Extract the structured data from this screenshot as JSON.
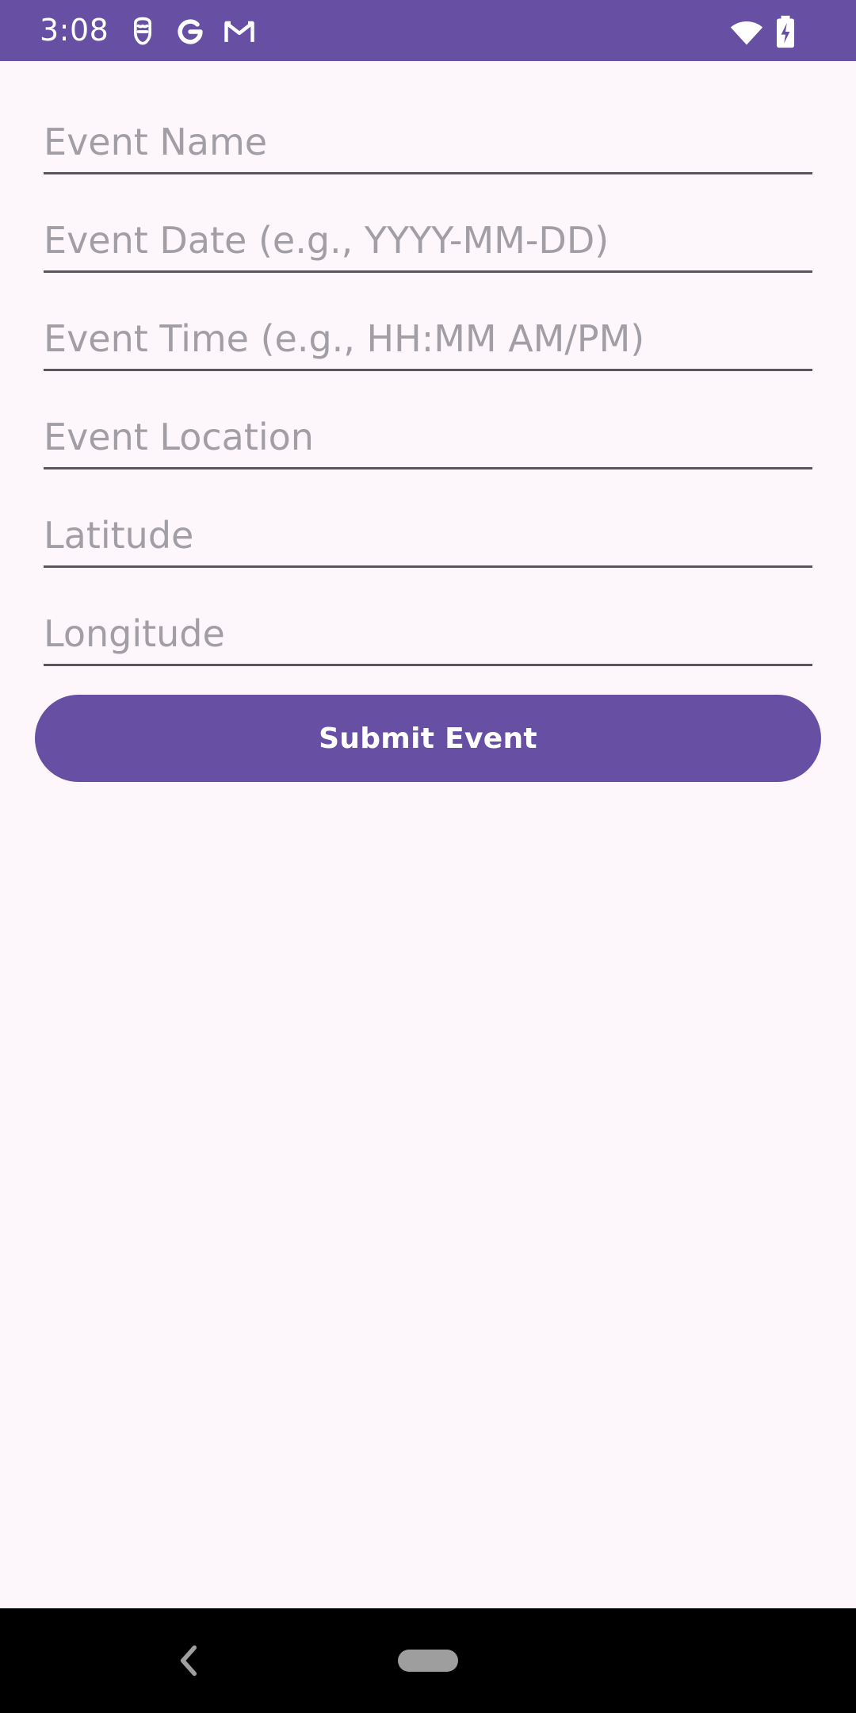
{
  "status_bar": {
    "time": "3:08",
    "background_color": "#6750a4",
    "left_icons": [
      "alien-face-icon",
      "google-g-icon",
      "gmail-icon"
    ],
    "right_icons": [
      "wifi-icon",
      "battery-charging-icon"
    ]
  },
  "form": {
    "fields": [
      {
        "name": "event-name",
        "value": "",
        "placeholder": "Event Name"
      },
      {
        "name": "event-date",
        "value": "",
        "placeholder": "Event Date (e.g., YYYY-MM-DD)"
      },
      {
        "name": "event-time",
        "value": "",
        "placeholder": "Event Time (e.g., HH:MM AM/PM)"
      },
      {
        "name": "event-location",
        "value": "",
        "placeholder": "Event Location"
      },
      {
        "name": "latitude",
        "value": "",
        "placeholder": "Latitude"
      },
      {
        "name": "longitude",
        "value": "",
        "placeholder": "Longitude"
      }
    ],
    "submit_label": "Submit Event",
    "accent_color": "#6750a4"
  },
  "nav_bar": {
    "icons": [
      "back-chevron-icon",
      "home-pill-icon"
    ]
  }
}
